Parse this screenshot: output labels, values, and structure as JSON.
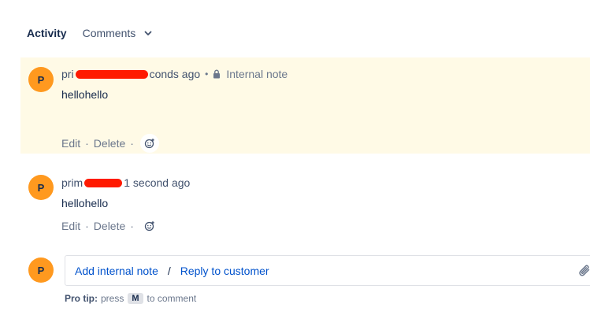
{
  "activity": {
    "title": "Activity",
    "filter_label": "Comments"
  },
  "comments": [
    {
      "avatar_initial": "P",
      "author_visible_prefix": "pri",
      "time_suffix": "conds ago",
      "tag": "Internal note",
      "body": "hellohello",
      "actions": {
        "edit": "Edit",
        "delete": "Delete",
        "sep": "·"
      },
      "background": "#fffae6"
    },
    {
      "avatar_initial": "P",
      "author_visible_prefix": "prim",
      "time_suffix": "1 second ago",
      "body": "hellohello",
      "actions": {
        "edit": "Edit",
        "delete": "Delete",
        "sep": "·"
      }
    }
  ],
  "composer": {
    "avatar_initial": "P",
    "internal_label": "Add internal note",
    "slash": "/",
    "reply_label": "Reply to customer"
  },
  "protip": {
    "label": "Pro tip:",
    "before": "press",
    "key": "M",
    "after": "to comment"
  },
  "colors": {
    "avatar": "#ff991f",
    "link": "#0052cc",
    "redaction": "#ff1a00",
    "internal_bg": "#fffae6"
  }
}
